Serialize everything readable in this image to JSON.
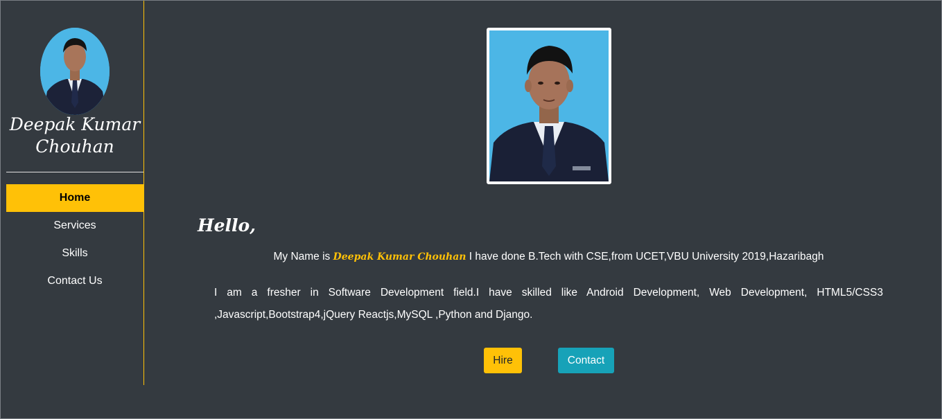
{
  "sidebar": {
    "avatar_alt": "profile photo",
    "name_line1": "Deepak Kumar",
    "name_line2": "Chouhan",
    "nav": [
      {
        "label": "Home",
        "active": true
      },
      {
        "label": "Services",
        "active": false
      },
      {
        "label": "Skills",
        "active": false
      },
      {
        "label": "Contact Us",
        "active": false
      }
    ]
  },
  "main": {
    "photo_alt": "profile photo",
    "greeting": "Hello,",
    "intro_prefix": "My Name is",
    "intro_name": "Deepak Kumar Chouhan",
    "intro_suffix": "I have done B.Tech with CSE,from UCET,VBU University 2019,Hazaribagh",
    "about": "I am a fresher in Software Development field.I have skilled like Android Development, Web Development, HTML5/CSS3 ,Javascript,Bootstrap4,jQuery Reactjs,MySQL ,Python and Django.",
    "buttons": {
      "hire": "Hire",
      "contact": "Contact"
    }
  },
  "colors": {
    "background": "#343a40",
    "accent": "#ffc107",
    "info": "#17a2b8",
    "photo_bg": "#4cb6e6"
  }
}
